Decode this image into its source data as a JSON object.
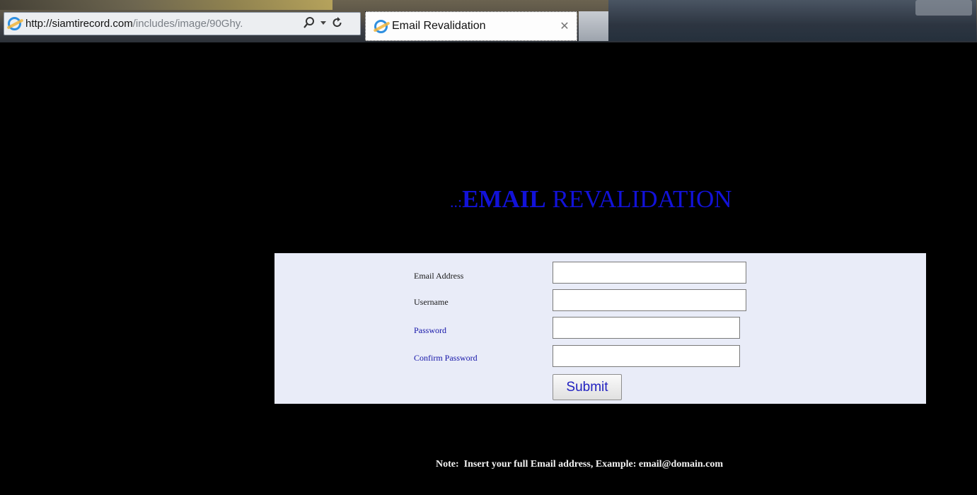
{
  "browser": {
    "url_host": "http://siamtirecord.com",
    "url_path": "/includes/image/90Ghy.",
    "tab_title": "Email Revalidation"
  },
  "page": {
    "heading_prefix": "..:",
    "heading_bold": "EMAIL",
    "heading_rest": " REVALIDATION",
    "form": {
      "email_label": "Email Address",
      "email_value": "",
      "username_label": "Username",
      "username_value": "",
      "password_label": "Password",
      "password_value": "",
      "confirm_label": "Confirm Password",
      "confirm_value": "",
      "submit_label": "Submit"
    },
    "note": "Note:  Insert your full Email address, Example: email@domain.com"
  }
}
